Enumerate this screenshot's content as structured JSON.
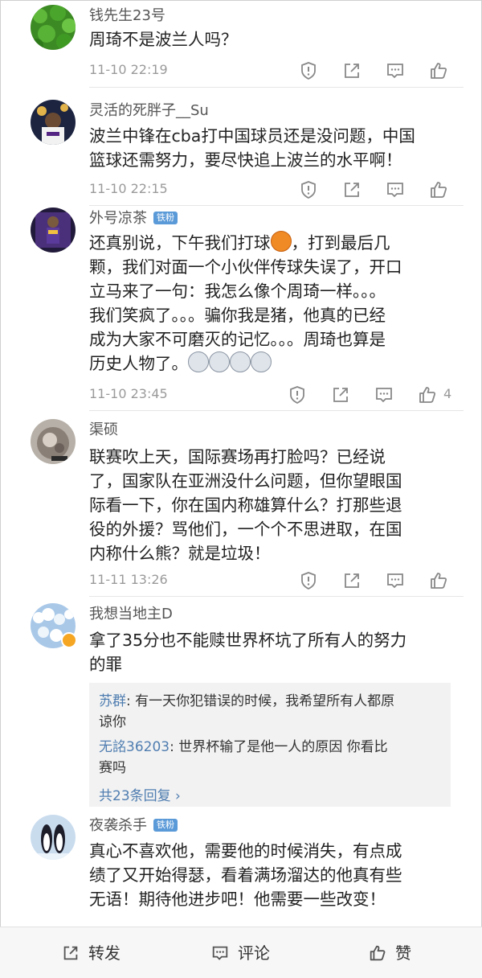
{
  "comments": [
    {
      "user": "钱先生23号",
      "badge": "",
      "lines": [
        "周琦不是波兰人吗？"
      ],
      "date": "11-10 22:19",
      "likes": ""
    },
    {
      "user": "灵活的死胖子__Su",
      "badge": "",
      "lines": [
        "波兰中锋在cba打中国球员还是没问题，中国",
        "篮球还需努力，要尽快追上波兰的水平啊！"
      ],
      "date": "11-10 22:15",
      "likes": ""
    },
    {
      "user": "外号凉茶",
      "badge": "铁粉",
      "lines": [
        "还真别说，下午我们打球",
        "，打到最后几",
        "颗，我们对面一个小伙伴传球失误了，开口",
        "立马来了一句：我怎么像个周琦一样。。。",
        "我们笑疯了。。。骗你我是猪，他真的已经",
        "成为大家不可磨灭的记忆。。。周琦也算是",
        "历史人物了。"
      ],
      "date": "11-10 23:45",
      "likes": "4"
    },
    {
      "user": "渠硕",
      "badge": "",
      "lines": [
        "联赛吹上天，国际赛场再打脸吗？已经说",
        "了，国家队在亚洲没什么问题，但你望眼国",
        "际看一下，你在国内称雄算什么？打那些退",
        "役的外援？骂他们，一个个不思进取，在国",
        "内称什么熊？就是垃圾！"
      ],
      "date": "11-11 13:26",
      "likes": ""
    },
    {
      "user": "我想当地主D",
      "badge": "",
      "lines": [
        "拿了35分也不能赎世界杯坑了所有人的努力",
        "的罪"
      ],
      "date": "",
      "likes": ""
    },
    {
      "user": "夜袭杀手",
      "badge": "铁粉",
      "lines": [
        "真心不喜欢他，需要他的时候消失，有点成",
        "绩了又开始得瑟，看着满场溜达的他真有些",
        "无语！期待他进步吧！他需要一些改变！"
      ],
      "date": "",
      "likes": ""
    }
  ],
  "replies": [
    {
      "name": "苏群",
      "lines": [
        "有一天你犯错误的时候，我希望所有人都原",
        "谅你"
      ]
    },
    {
      "name": "无詺36203",
      "lines": [
        "世界杯输了是他一人的原因  你看比",
        "赛吗"
      ]
    }
  ],
  "more_replies": "共23条回复 ›",
  "bottom_bar": {
    "forward": "转发",
    "comment": "评论",
    "like": "赞"
  },
  "colors": {
    "link": "#4f7db0",
    "badge": "#5b9ad8",
    "meta": "#9a9a9a"
  },
  "icons": [
    "report-icon",
    "share-icon",
    "comment-icon",
    "like-icon",
    "basketball-emoji",
    "husky-emoji"
  ]
}
